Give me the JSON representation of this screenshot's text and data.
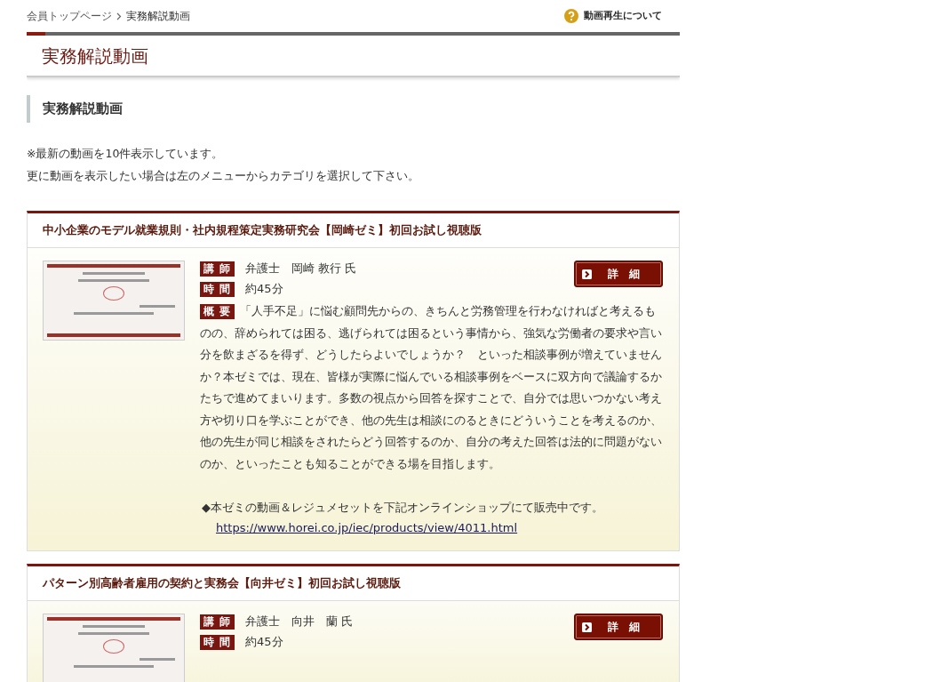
{
  "breadcrumb": [
    "会員トップページ",
    "実務解説動画"
  ],
  "help_link": "動画再生について",
  "page_title": "実務解説動画",
  "section_title": "実務解説動画",
  "notes": [
    "※最新の動画を10件表示しています。",
    "更に動画を表示したい場合は左のメニューからカテゴリを選択して下さい。"
  ],
  "videos": [
    {
      "title": "中小企業のモデル就業規則・社内規程策定実務研究会【岡崎ゼミ】初回お試し視聴版",
      "details_button": "詳　細",
      "fields": [
        {
          "label": "講 師",
          "value": "弁護士　岡崎 教行 氏"
        },
        {
          "label": "時 間",
          "value": "約45分"
        }
      ],
      "summary_label": "概 要",
      "summary": "「人手不足」に悩む顧問先からの、きちんと労務管理を行わなければと考えるものの、辞められては困る、逃げられては困るという事情から、強気な労働者の要求や言い分を飲まざるを得ず、どうしたらよいでしょうか？　といった相談事例が増えていませんか？本ゼミでは、現在、皆様が実際に悩んでいる相談事例をベースに双方向で議論するかたちで進めてまいります。多数の視点から回答を探すことで、自分では思いつかない考え方や切り口を学ぶことができ、他の先生は相談にのるときにどういうことを考えるのか、他の先生が同じ相談をされたらどう回答するのか、自分の考えた回答は法的に問題がないのか、といったことも知ることができる場を目指します。",
      "sale_note": "◆本ゼミの動画＆レジュメセットを下記オンラインショップにて販売中です。",
      "link": "https://www.horei.co.jp/iec/products/view/4011.html"
    },
    {
      "title": "パターン別高齢者雇用の契約と実務会【向井ゼミ】初回お試し視聴版",
      "details_button": "詳　細",
      "fields": [
        {
          "label": "講 師",
          "value": "弁護士　向井　蘭 氏"
        },
        {
          "label": "時 間",
          "value": "約45分"
        }
      ]
    }
  ]
}
